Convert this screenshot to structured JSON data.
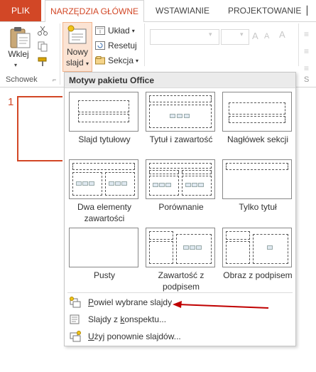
{
  "tabs": {
    "file": "PLIK",
    "home": "NARZĘDZIA GŁÓWNE",
    "insert": "WSTAWIANIE",
    "design": "PROJEKTOWANIE"
  },
  "ribbon": {
    "paste_label": "Wklej",
    "new_slide_line1": "Nowy",
    "new_slide_line2": "slajd",
    "layout_label": "Układ",
    "reset_label": "Resetuj",
    "section_label": "Sekcja",
    "clipboard_group": "Schowek",
    "slides_group_partial": "S"
  },
  "slides_pane": {
    "slide_number": "1"
  },
  "gallery": {
    "header": "Motyw pakietu Office",
    "layouts": [
      {
        "label": "Slajd tytułowy"
      },
      {
        "label": "Tytuł i zawartość"
      },
      {
        "label": "Nagłówek sekcji"
      },
      {
        "label": "Dwa elementy zawartości"
      },
      {
        "label": "Porównanie"
      },
      {
        "label": "Tylko tytuł"
      },
      {
        "label": "Pusty"
      },
      {
        "label": "Zawartość z podpisem"
      },
      {
        "label": "Obraz z podpisem"
      }
    ],
    "menu": {
      "duplicate_pre": "",
      "duplicate_u": "P",
      "duplicate_post": "owiel wybrane slajdy",
      "outline_pre": "Slajdy z ",
      "outline_u": "k",
      "outline_post": "onspektu...",
      "reuse_pre": "",
      "reuse_u": "U",
      "reuse_post": "żyj ponownie slajdów..."
    }
  },
  "colors": {
    "accent": "#d24726",
    "annotation_arrow": "#c00000"
  }
}
